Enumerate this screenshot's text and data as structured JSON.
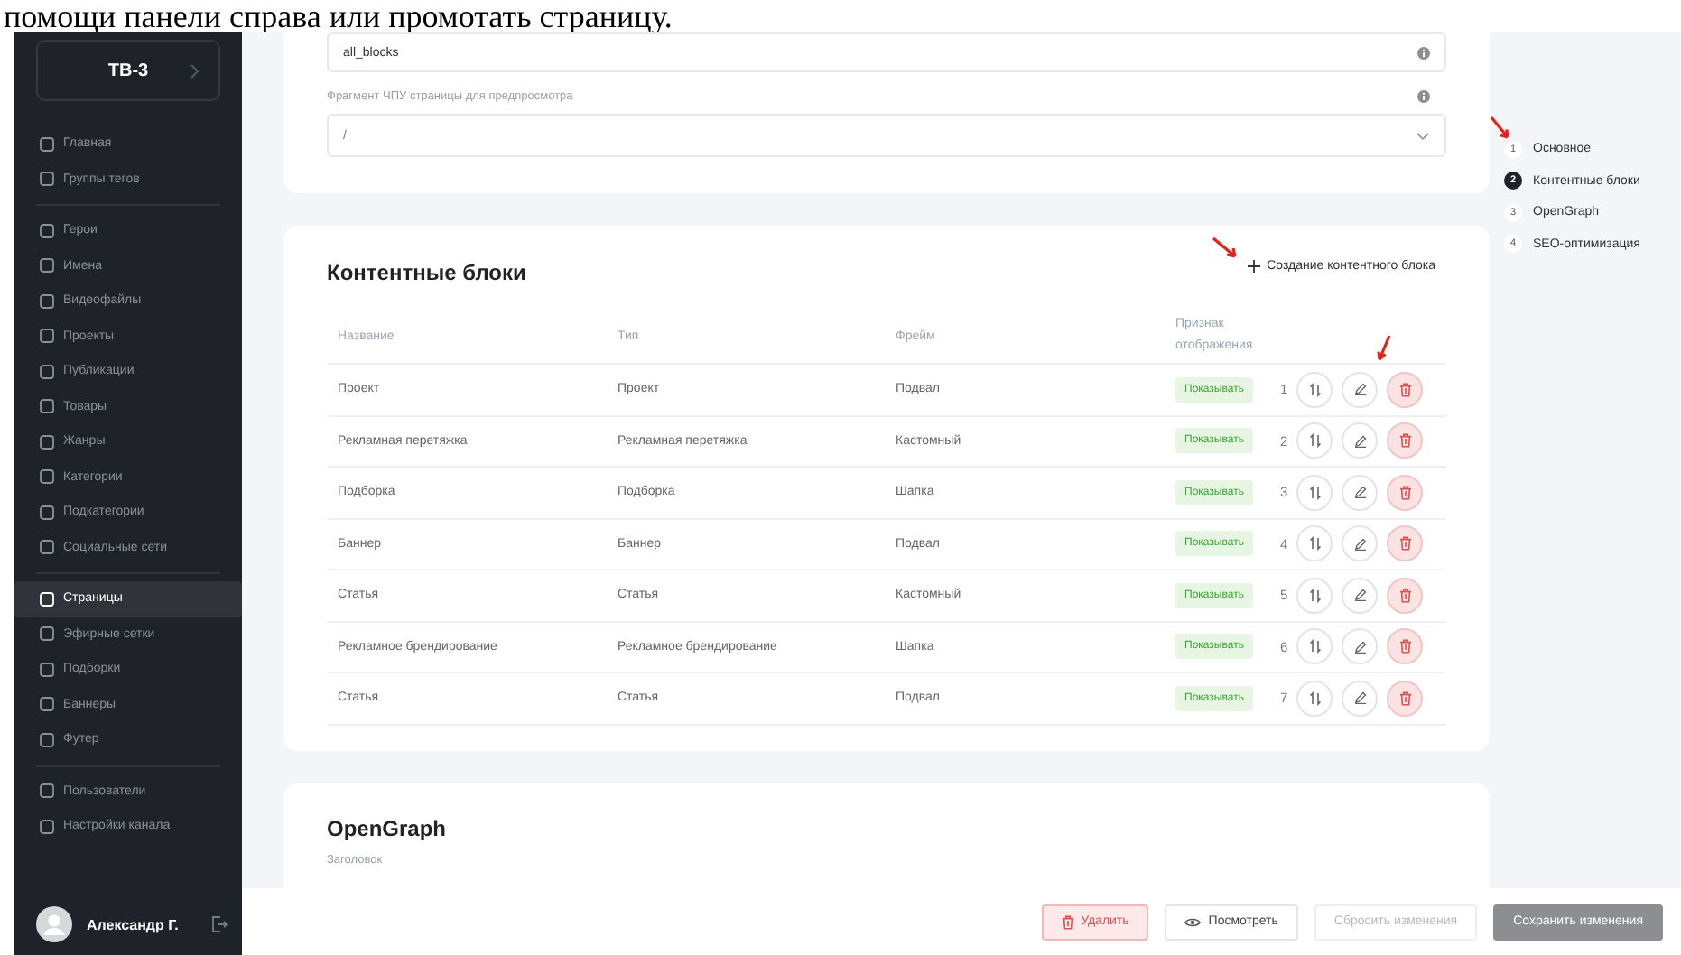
{
  "caption": "помощи панели справа или промотать страницу.",
  "sidebar": {
    "brand": "ТВ-3",
    "groups": [
      [
        {
          "label": "Главная",
          "selected": false
        },
        {
          "label": "Группы тегов",
          "selected": false
        }
      ],
      [
        {
          "label": "Герои",
          "selected": false
        },
        {
          "label": "Имена",
          "selected": false
        },
        {
          "label": "Видеофайлы",
          "selected": false
        },
        {
          "label": "Проекты",
          "selected": false
        },
        {
          "label": "Публикации",
          "selected": false
        },
        {
          "label": "Товары",
          "selected": false
        },
        {
          "label": "Жанры",
          "selected": false
        },
        {
          "label": "Категории",
          "selected": false
        },
        {
          "label": "Подкатегории",
          "selected": false
        },
        {
          "label": "Социальные сети",
          "selected": false
        }
      ],
      [
        {
          "label": "Страницы",
          "selected": true
        },
        {
          "label": "Эфирные сетки",
          "selected": false
        },
        {
          "label": "Подборки",
          "selected": false
        },
        {
          "label": "Баннеры",
          "selected": false
        },
        {
          "label": "Футер",
          "selected": false
        }
      ],
      [
        {
          "label": "Пользователи",
          "selected": false
        },
        {
          "label": "Настройки канала",
          "selected": false
        }
      ]
    ],
    "user": "Александр Г."
  },
  "main_card": {
    "block_field": {
      "value": "all_blocks"
    },
    "preview_field": {
      "label": "Фрагмент ЧПУ страницы для предпросмотра",
      "value": "/"
    }
  },
  "content_blocks": {
    "title": "Контентные блоки",
    "create_link": "Создание контентного блока",
    "columns": [
      "Название",
      "Тип",
      "Фрейм",
      "Признак отображения"
    ],
    "rows": [
      {
        "name": "Проект",
        "type": "Проект",
        "frame": "Подвал",
        "display": "Показывать",
        "order": "1"
      },
      {
        "name": "Рекламная перетяжка",
        "type": "Рекламная перетяжка",
        "frame": "Кастомный",
        "display": "Показывать",
        "order": "2"
      },
      {
        "name": "Подборка",
        "type": "Подборка",
        "frame": "Шапка",
        "display": "Показывать",
        "order": "3"
      },
      {
        "name": "Баннер",
        "type": "Баннер",
        "frame": "Подвал",
        "display": "Показывать",
        "order": "4"
      },
      {
        "name": "Статья",
        "type": "Статья",
        "frame": "Кастомный",
        "display": "Показывать",
        "order": "5"
      },
      {
        "name": "Рекламное брендирование",
        "type": "Рекламное брендирование",
        "frame": "Шапка",
        "display": "Показывать",
        "order": "6"
      },
      {
        "name": "Статья",
        "type": "Статья",
        "frame": "Подвал",
        "display": "Показывать",
        "order": "7"
      }
    ]
  },
  "opengraph": {
    "title": "OpenGraph",
    "field_label": "Заголовок"
  },
  "steps": [
    {
      "number": "1",
      "label": "Основное",
      "selected": false
    },
    {
      "number": "2",
      "label": "Контентные блоки",
      "selected": true
    },
    {
      "number": "3",
      "label": "OpenGraph",
      "selected": false
    },
    {
      "number": "4",
      "label": "SEO-оптимизация",
      "selected": false
    }
  ],
  "actions": [
    {
      "label": "Удалить",
      "kind": "danger"
    },
    {
      "label": "Посмотреть",
      "kind": "view"
    },
    {
      "label": "Сбросить изменения",
      "kind": "disabled"
    },
    {
      "label": "Сохранить изменения",
      "kind": "primary"
    }
  ]
}
